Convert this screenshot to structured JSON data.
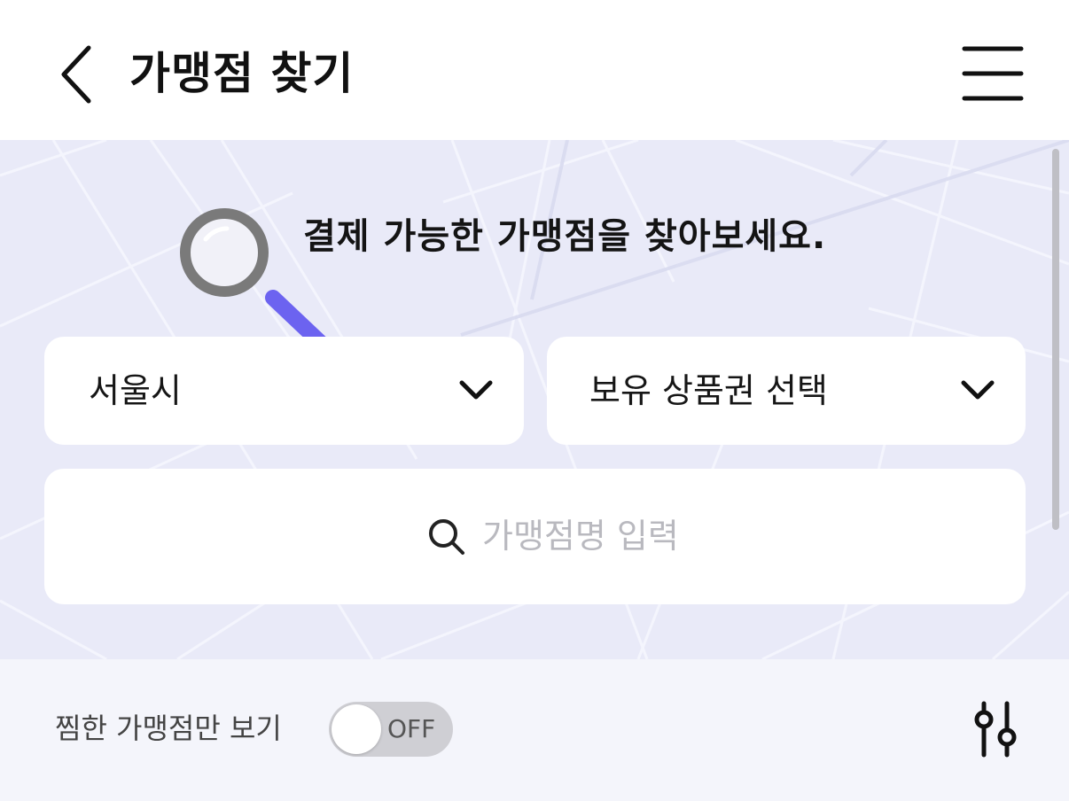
{
  "header": {
    "title": "가맹점 찾기",
    "back_icon": "chevron-left-icon",
    "menu_icon": "hamburger-menu-icon"
  },
  "hero": {
    "title": "결제 가능한 가맹점을 찾아보세요.",
    "illustration": "magnifying-glass-icon",
    "region_dropdown": {
      "value": "서울시",
      "icon": "chevron-down-icon"
    },
    "voucher_dropdown": {
      "value": "보유 상품권 선택",
      "icon": "chevron-down-icon"
    },
    "search": {
      "placeholder": "가맹점명 입력",
      "value": "",
      "icon": "search-icon"
    }
  },
  "filter_bar": {
    "favorites_label": "찜한 가맹점만 보기",
    "toggle": {
      "state": "OFF",
      "on": false
    },
    "filter_icon": "sliders-filter-icon"
  },
  "colors": {
    "accent": "#6c63f0",
    "hero_bg": "#e9eaf8",
    "filter_bar_bg": "#f4f5fb",
    "toggle_off": "#cfcfd4"
  }
}
